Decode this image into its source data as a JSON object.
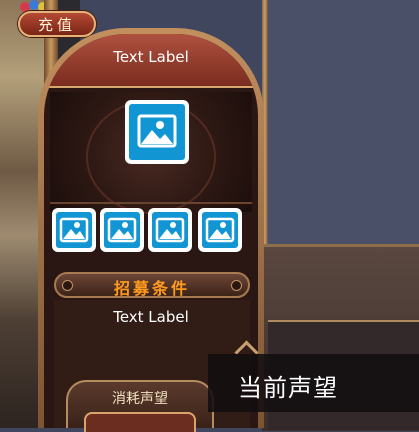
{
  "topbar": {
    "recharge_label": "充值"
  },
  "card": {
    "title": "Text Label",
    "portrait_icon": "image-placeholder-icon",
    "slot_icons": [
      "image-placeholder-icon",
      "image-placeholder-icon",
      "image-placeholder-icon",
      "image-placeholder-icon"
    ],
    "section_title": "招募条件",
    "section_body": "Text Label",
    "consume_tab_label": "消耗声望"
  },
  "tooltip": {
    "text": "当前声望"
  },
  "colors": {
    "accent_orange": "#ff9b1e",
    "header_red": "#b0513f",
    "image_blue": "#1296d3",
    "frame_gold": "#c28f5e"
  }
}
